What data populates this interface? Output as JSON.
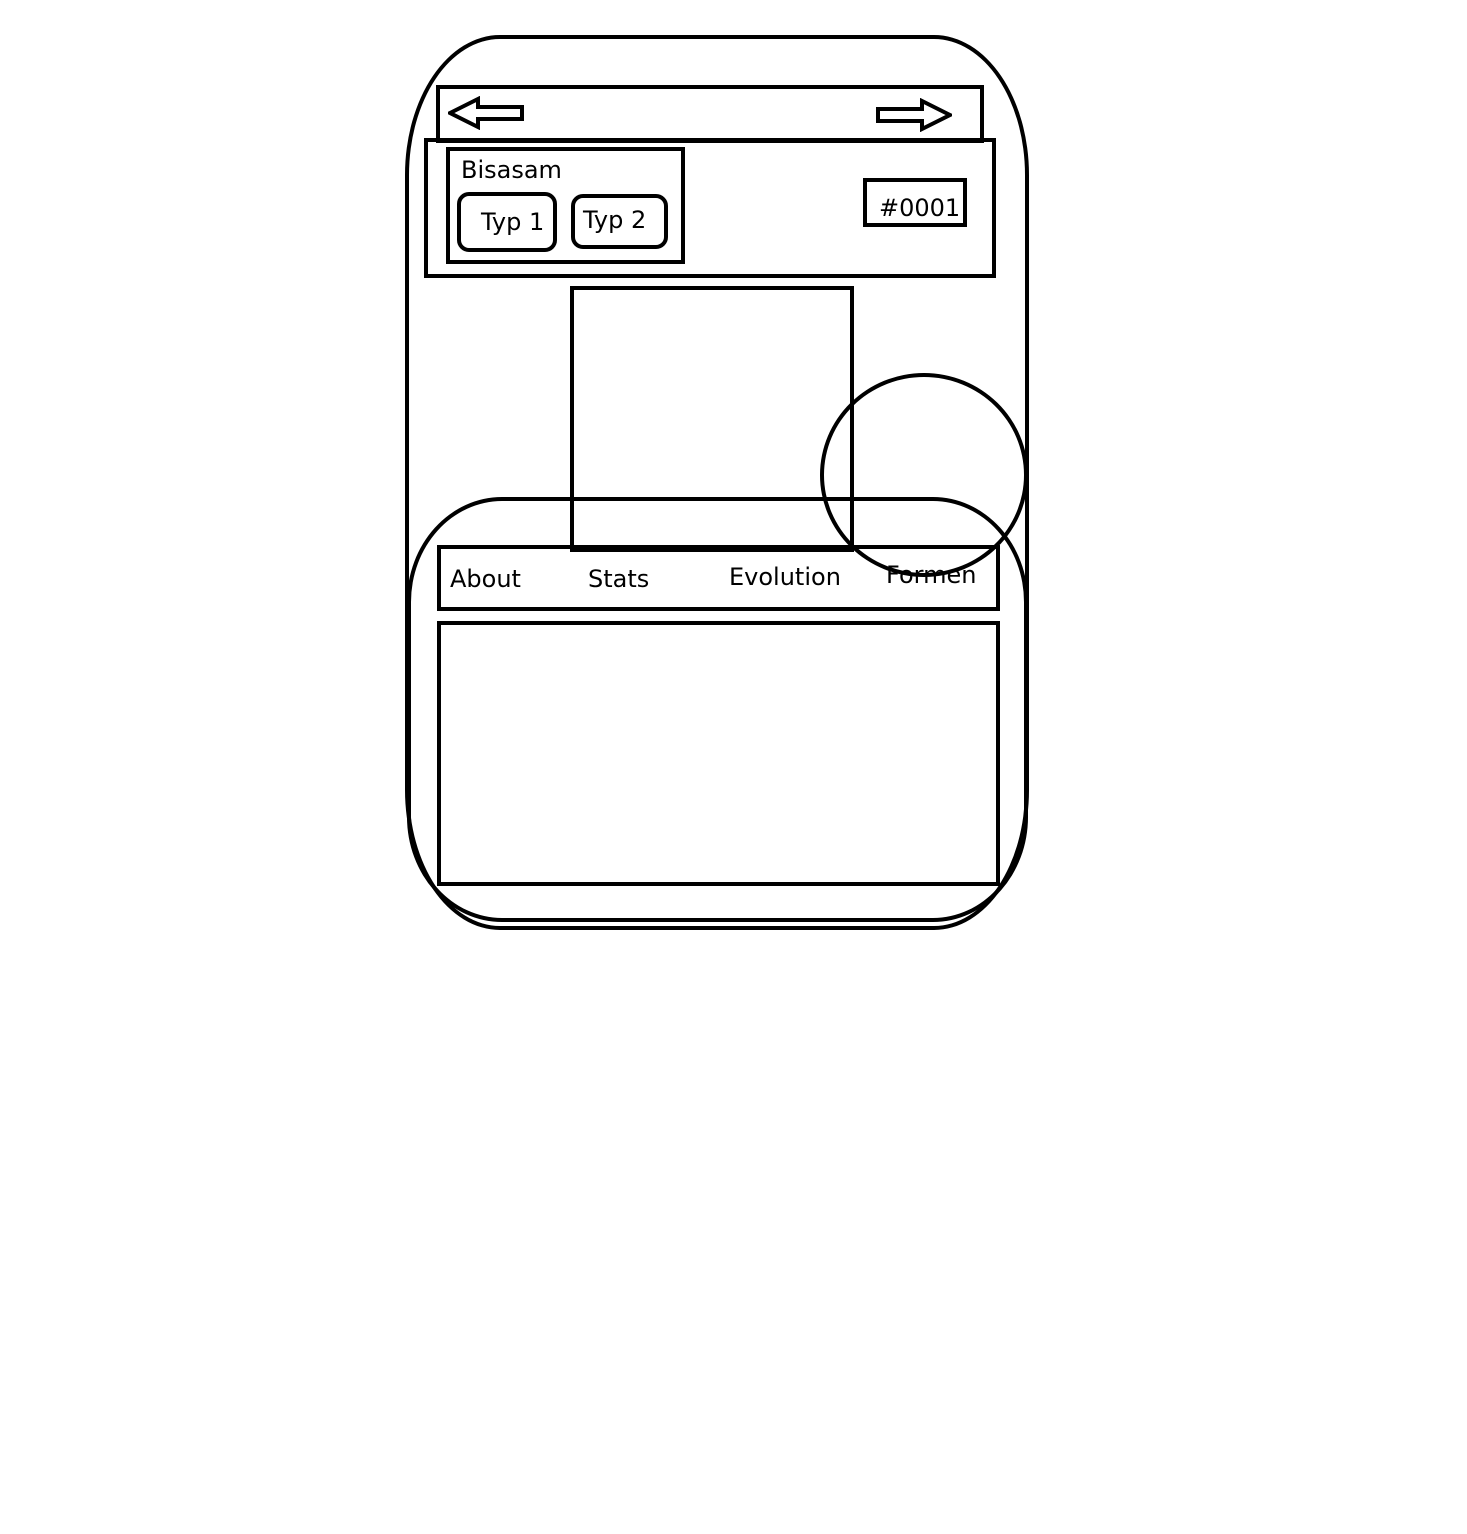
{
  "header": {
    "pokemon_name": "Bisasam",
    "types": [
      "Typ 1",
      "Typ 2"
    ],
    "dex_number": "#0001"
  },
  "navigation": {
    "previous_icon": "arrow-left-icon",
    "next_icon": "arrow-right-icon"
  },
  "tabs": [
    {
      "label": "About"
    },
    {
      "label": "Stats"
    },
    {
      "label": "Evolution"
    },
    {
      "label": "Formen"
    }
  ],
  "colors": {
    "stroke": "#000000",
    "background": "#ffffff"
  }
}
